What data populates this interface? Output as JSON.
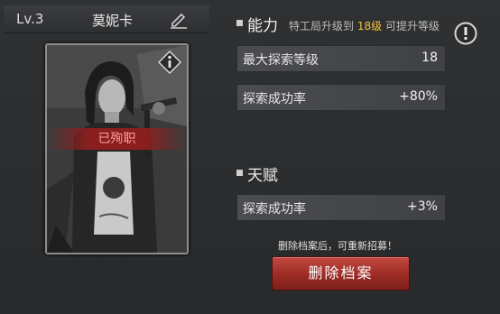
{
  "agent": {
    "level": "Lv.3",
    "name": "莫妮卡",
    "status": "已殉职"
  },
  "ability": {
    "title": "能力",
    "hint_prefix": "特工局升级到",
    "hint_level": "18级",
    "hint_suffix": "可提升等级",
    "stats": [
      {
        "label": "最大探索等级",
        "value": "18"
      },
      {
        "label": "探索成功率",
        "value": "+80%"
      }
    ]
  },
  "talent": {
    "title": "天赋",
    "stats": [
      {
        "label": "探索成功率",
        "value": "+3%"
      }
    ]
  },
  "footer": {
    "notice": "删除档案后，可重新招募！",
    "delete_label": "删除档案"
  },
  "icons": [
    "edit-pencil-icon",
    "info-icon",
    "warning-icon"
  ]
}
